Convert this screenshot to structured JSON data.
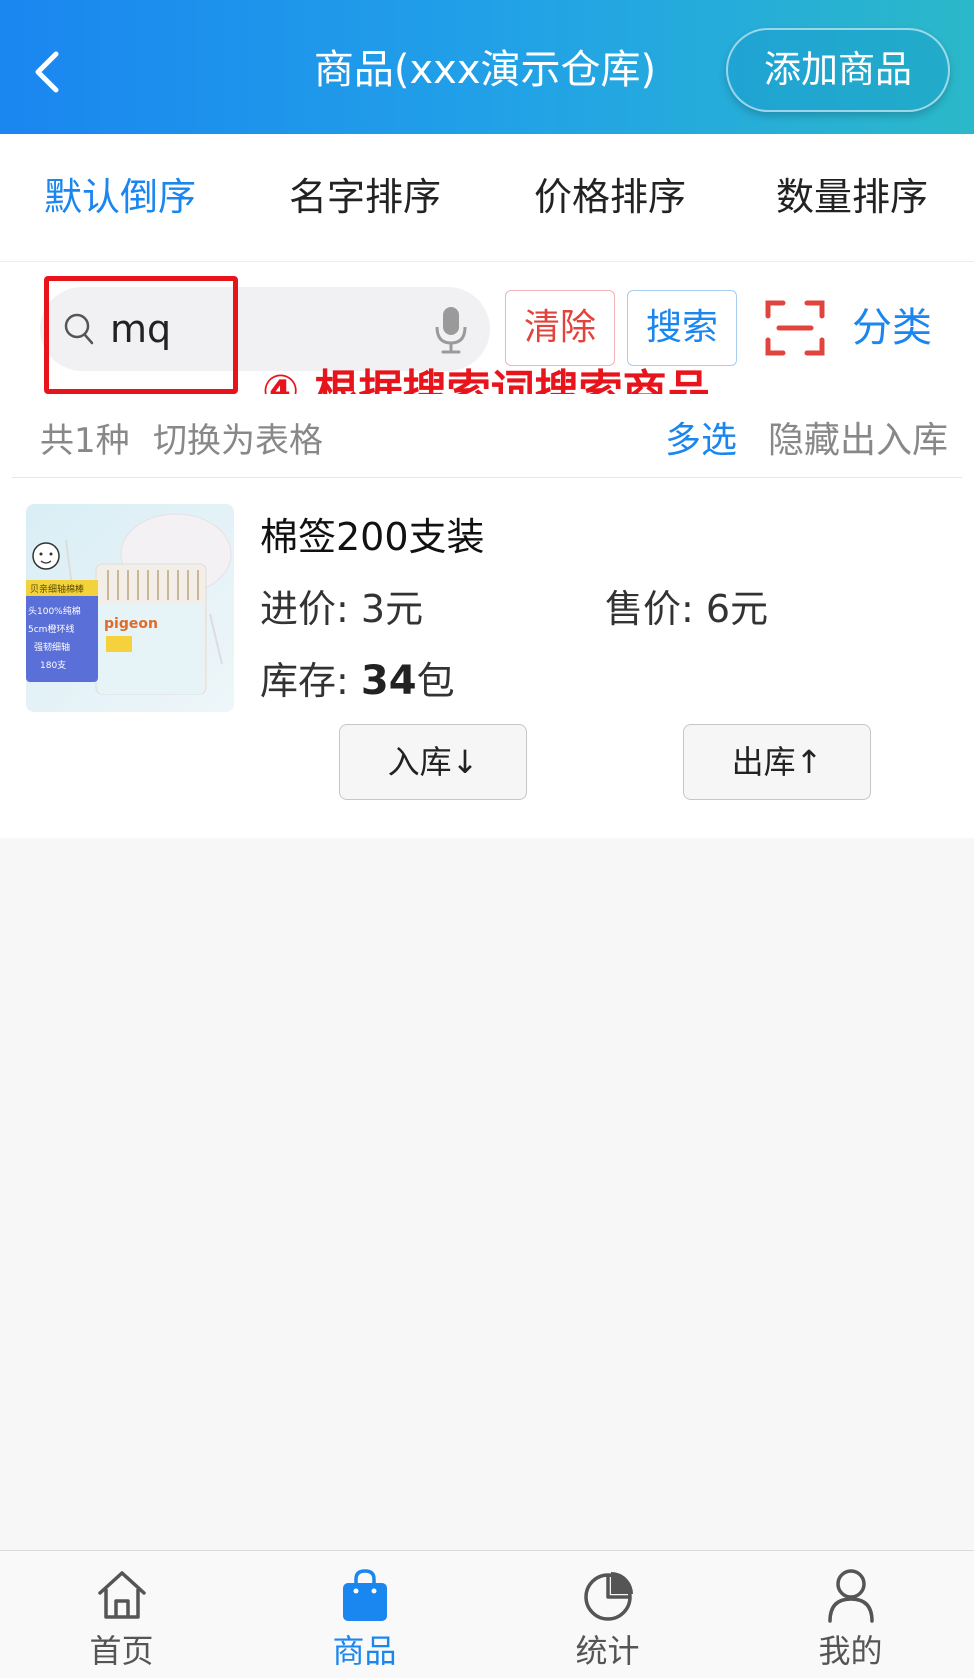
{
  "header": {
    "title": "商品(xxx演示仓库)",
    "add_button": "添加商品"
  },
  "sort_tabs": [
    {
      "label": "默认倒序",
      "active": true
    },
    {
      "label": "名字排序",
      "active": false
    },
    {
      "label": "价格排序",
      "active": false
    },
    {
      "label": "数量排序",
      "active": false
    }
  ],
  "search": {
    "value": "mq",
    "clear_label": "清除",
    "search_label": "搜索",
    "category_label": "分类"
  },
  "annotation": "④ 根据搜索词搜索商品",
  "list_info": {
    "count": "共1种",
    "toggle_table": "切换为表格",
    "multi_select": "多选",
    "hide_io": "隐藏出入库"
  },
  "products": [
    {
      "name": "棉签200支装",
      "cost_label": "进价:",
      "cost_value": "3元",
      "sale_label": "售价:",
      "sale_value": "6元",
      "stock_label": "库存:",
      "stock_qty": "34",
      "stock_unit": "包",
      "in_button": "入库↓",
      "out_button": "出库↑",
      "image": {
        "brand": "pigeon",
        "text_lines": [
          "贝亲细轴棉棒",
          "头100%纯棉",
          "5cm橙环线",
          "强韧细轴",
          "180支"
        ]
      }
    }
  ],
  "tabbar": [
    {
      "label": "首页",
      "icon": "home-icon",
      "active": false
    },
    {
      "label": "商品",
      "icon": "shopping-bag-icon",
      "active": true
    },
    {
      "label": "统计",
      "icon": "pie-chart-icon",
      "active": false
    },
    {
      "label": "我的",
      "icon": "user-icon",
      "active": false
    }
  ],
  "colors": {
    "accent": "#1a86f0",
    "danger": "#e0443d",
    "annotation": "#e8141c",
    "header_gradient_start": "#1a86f0",
    "header_gradient_end": "#2bb8c9"
  }
}
